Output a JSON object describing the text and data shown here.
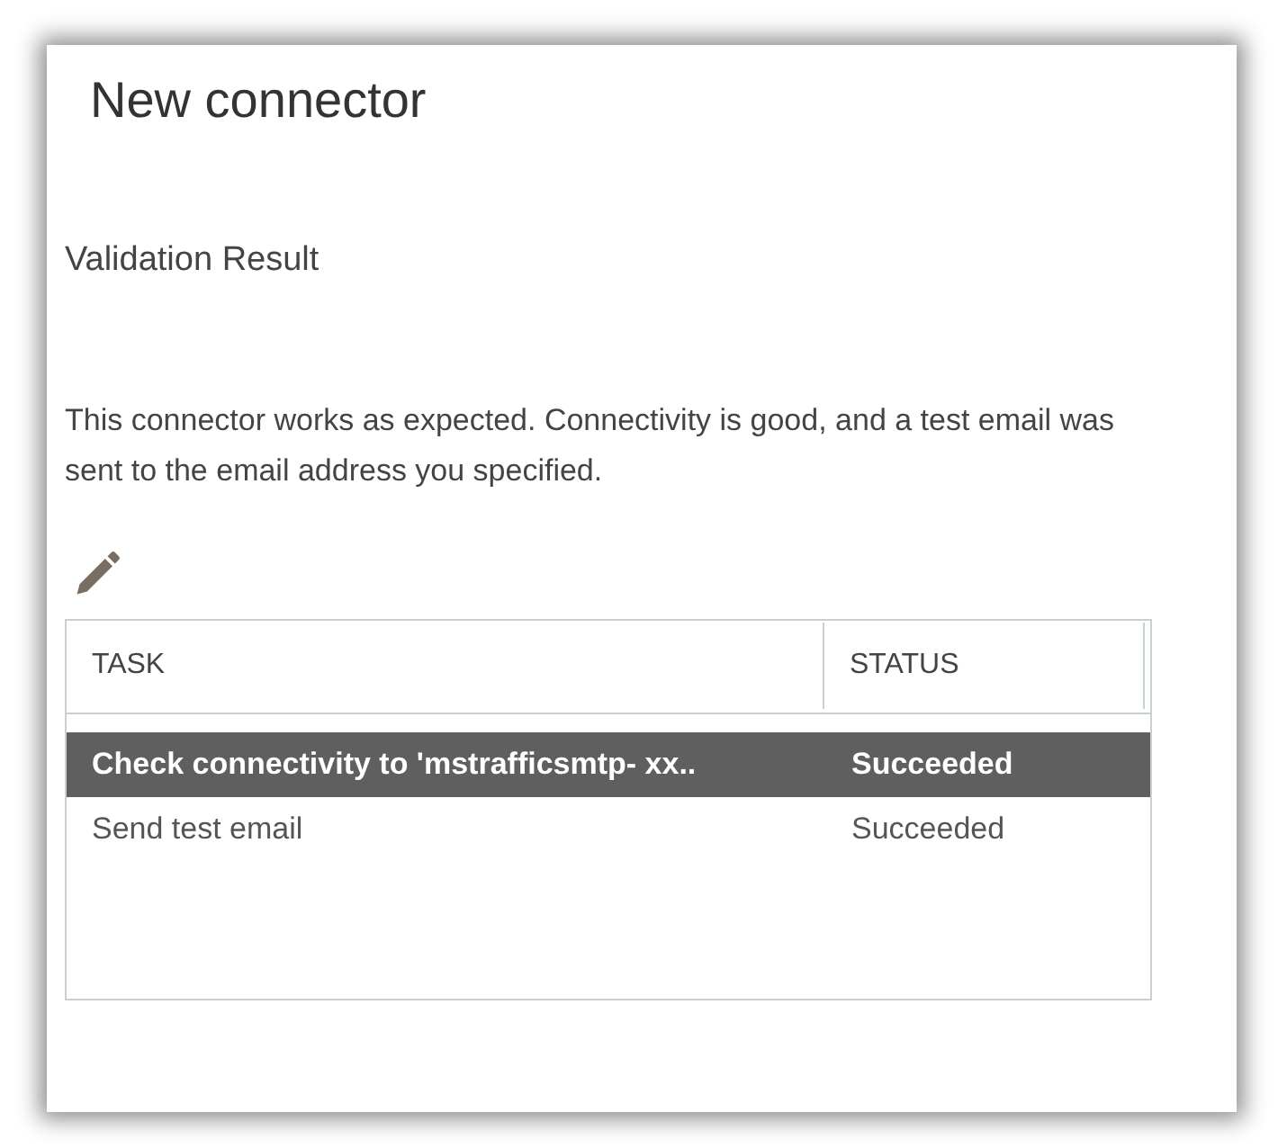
{
  "title": "New connector",
  "section_heading": "Validation Result",
  "message": "This connector works as expected. Connectivity is good, and a test email was sent to the email address you specified.",
  "table": {
    "columns": [
      "TASK",
      "STATUS"
    ],
    "rows": [
      {
        "task": "Check connectivity to 'mstrafficsmtp- xx..",
        "status": "Succeeded",
        "selected": true
      },
      {
        "task": "Send test email",
        "status": "Succeeded",
        "selected": false
      }
    ]
  }
}
